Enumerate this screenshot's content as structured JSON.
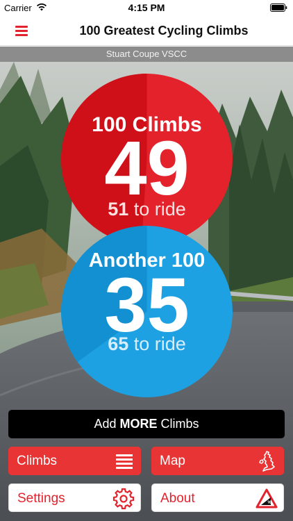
{
  "status_bar": {
    "carrier": "Carrier",
    "time": "4:15 PM"
  },
  "nav": {
    "title": "100 Greatest Cycling Climbs",
    "menu_icon": "hamburger-icon"
  },
  "user": {
    "name": "Stuart Coupe VSCC"
  },
  "collections": [
    {
      "title": "100 Climbs",
      "completed": "49",
      "remaining": "51",
      "remaining_suffix": " to ride",
      "completed_fraction": 0.49,
      "color": "#e3222c"
    },
    {
      "title": "Another 100",
      "completed": "35",
      "remaining": "65",
      "remaining_suffix": " to ride",
      "completed_fraction": 0.35,
      "color": "#1da1e2"
    }
  ],
  "actions": {
    "add_more": {
      "prefix": "Add ",
      "bold": "MORE",
      "suffix": " Climbs"
    },
    "climbs": {
      "label": "Climbs",
      "icon": "list-icon"
    },
    "map": {
      "label": "Map",
      "icon": "uk-map-icon"
    },
    "settings": {
      "label": "Settings",
      "icon": "gear-icon"
    },
    "about": {
      "label": "About",
      "icon": "gradient-warning-icon"
    }
  },
  "colors": {
    "accent_red": "#e3222c",
    "accent_blue": "#1da1e2"
  }
}
